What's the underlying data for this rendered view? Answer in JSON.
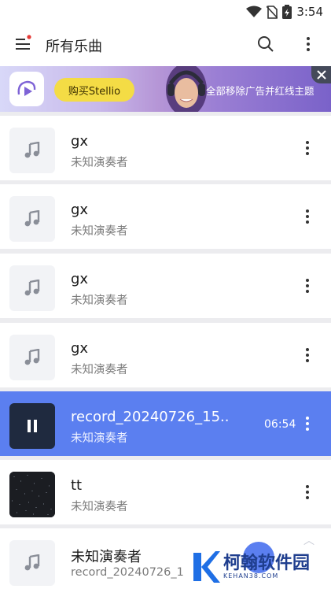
{
  "status_bar": {
    "time": "3:54"
  },
  "toolbar": {
    "title": "所有乐曲"
  },
  "banner": {
    "buy_label": "购买Stellio",
    "remove_ads_text": "全部移除广告并红线主题"
  },
  "songs": [
    {
      "title": "gx",
      "artist": "未知演奏者",
      "thumbnail": "music-note-icon"
    },
    {
      "title": "gx",
      "artist": "未知演奏者",
      "thumbnail": "music-note-icon"
    },
    {
      "title": "gx",
      "artist": "未知演奏者",
      "thumbnail": "music-note-icon"
    },
    {
      "title": "gx",
      "artist": "未知演奏者",
      "thumbnail": "music-note-icon"
    },
    {
      "title": "record_20240726_15..",
      "artist": "未知演奏者",
      "duration": "06:54",
      "thumbnail": "pause-icon",
      "playing": true
    },
    {
      "title": "tt",
      "artist": "未知演奏者",
      "thumbnail": "cover-image"
    },
    {
      "title": "未知演奏者",
      "artist": "record_20240726_1",
      "thumbnail": "music-note-icon"
    }
  ],
  "watermark": {
    "text": "柯翰软件园",
    "sub": "KEHAN38.COM"
  },
  "colors": {
    "accent": "#5b7ff0",
    "background": "#ececef",
    "banner_button": "#f4dc45"
  }
}
